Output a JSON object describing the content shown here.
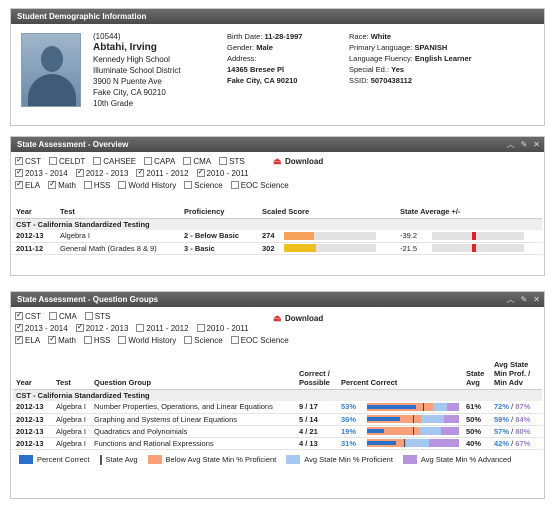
{
  "colors": {
    "header_bg": "#555555",
    "link_blue": "#3c7ec9",
    "purple": "#9e7ed0",
    "orange_bar": "#f7a25a",
    "yellow_bar": "#f0c020",
    "state_red": "#e0202a",
    "percent_blue": "#2a70c8",
    "below_orange": "#f7a07a",
    "at_blue": "#a6c8f0",
    "adv_purple": "#b794e0"
  },
  "student": {
    "header": "Student Demographic Information",
    "id": "(10544)",
    "name": "Abtahi, Irving",
    "school": "Kennedy High School",
    "district": "Illuminate School District",
    "address1": "3900 N Puente Ave",
    "address2": "Fake City, CA 90210",
    "grade": "10th Grade",
    "birth_label": "Birth Date:",
    "birth": "11-28-1997",
    "gender_label": "Gender:",
    "gender": "Male",
    "address_label": "Address:",
    "addr_line1": "14365 Bresee Pl",
    "addr_line2": "Fake City, CA 90210",
    "race_label": "Race:",
    "race": "White",
    "lang_label": "Primary Language:",
    "lang": "SPANISH",
    "fluency_label": "Language Fluency:",
    "fluency": "English Learner",
    "sped_label": "Special Ed.:",
    "sped": "Yes",
    "ssid_label": "SSID:",
    "ssid": "5070438112"
  },
  "overview": {
    "header": "State Assessment - Overview",
    "tests": [
      {
        "label": "CST",
        "checked": true
      },
      {
        "label": "CELDT",
        "checked": false
      },
      {
        "label": "CAHSEE",
        "checked": false
      },
      {
        "label": "CAPA",
        "checked": false
      },
      {
        "label": "CMA",
        "checked": false
      },
      {
        "label": "STS",
        "checked": false
      }
    ],
    "years": [
      {
        "label": "2013 - 2014",
        "checked": true
      },
      {
        "label": "2012 - 2013",
        "checked": true
      },
      {
        "label": "2011 - 2012",
        "checked": true
      },
      {
        "label": "2010 - 2011",
        "checked": true
      }
    ],
    "subjects": [
      {
        "label": "ELA",
        "checked": true
      },
      {
        "label": "Math",
        "checked": true
      },
      {
        "label": "HSS",
        "checked": false
      },
      {
        "label": "World History",
        "checked": false
      },
      {
        "label": "Science",
        "checked": false
      },
      {
        "label": "EOC Science",
        "checked": false
      }
    ],
    "download": "Download",
    "columns": [
      "Year",
      "Test",
      "Proficiency",
      "Scaled Score",
      "State Average +/-"
    ],
    "group": "CST - California Standardized Testing",
    "rows": [
      {
        "year": "2012-13",
        "test": "Algebra I",
        "prof": "2 - Below Basic",
        "score": "274",
        "score_frac": 0.33,
        "bar_color": "#f7a25a",
        "avg": "-39.2",
        "avg_frac": 0.43
      },
      {
        "year": "2011-12",
        "test": "General Math (Grades 8 & 9)",
        "prof": "3 - Basic",
        "score": "302",
        "score_frac": 0.35,
        "bar_color": "#f0c020",
        "avg": "-21.5",
        "avg_frac": 0.43
      }
    ]
  },
  "groups": {
    "header": "State Assessment - Question Groups",
    "tests": [
      {
        "label": "CST",
        "checked": true
      },
      {
        "label": "CMA",
        "checked": false
      },
      {
        "label": "STS",
        "checked": false
      }
    ],
    "years": [
      {
        "label": "2013 - 2014",
        "checked": true
      },
      {
        "label": "2012 - 2013",
        "checked": true
      },
      {
        "label": "2011 - 2012",
        "checked": false
      },
      {
        "label": "2010 - 2011",
        "checked": false
      }
    ],
    "subjects": [
      {
        "label": "ELA",
        "checked": true
      },
      {
        "label": "Math",
        "checked": true
      },
      {
        "label": "HSS",
        "checked": false
      },
      {
        "label": "World History",
        "checked": false
      },
      {
        "label": "Science",
        "checked": false
      },
      {
        "label": "EOC Science",
        "checked": false
      }
    ],
    "download": "Download",
    "col_year": "Year",
    "col_test": "Test",
    "col_qgroup": "Question Group",
    "col_correct": "Correct / Possible",
    "col_pct": "Percent Correct",
    "col_state": "State Avg",
    "col_minprof": "Avg State Min Prof. / Min Adv",
    "group": "CST - California Standardized Testing",
    "rows": [
      {
        "year": "2012-13",
        "test": "Algebra I",
        "qgroup": "Number Properties, Operations, and Linear Equations",
        "correct": "9 / 17",
        "pct": "53%",
        "pct_v": 53,
        "state": "61%",
        "state_v": 61,
        "minprof": "72%",
        "minadv": "87%",
        "prof_v": 72,
        "adv_v": 87
      },
      {
        "year": "2012-13",
        "test": "Algebra I",
        "qgroup": "Graphing and Systems of Linear Equations",
        "correct": "5 / 14",
        "pct": "36%",
        "pct_v": 36,
        "state": "50%",
        "state_v": 50,
        "minprof": "59%",
        "minadv": "84%",
        "prof_v": 59,
        "adv_v": 84
      },
      {
        "year": "2012-13",
        "test": "Algebra I",
        "qgroup": "Quadratics and Polynomials",
        "correct": "4 / 21",
        "pct": "19%",
        "pct_v": 19,
        "state": "50%",
        "state_v": 50,
        "minprof": "57%",
        "minadv": "80%",
        "prof_v": 57,
        "adv_v": 80
      },
      {
        "year": "2012-13",
        "test": "Algebra I",
        "qgroup": "Functions and Rational Expressions",
        "correct": "4 / 13",
        "pct": "31%",
        "pct_v": 31,
        "state": "40%",
        "state_v": 40,
        "minprof": "42%",
        "minadv": "67%",
        "prof_v": 42,
        "adv_v": 67
      }
    ],
    "legend": [
      {
        "label": "Percent Correct",
        "color": "#2a70c8",
        "kind": "swatch"
      },
      {
        "label": "State Avg",
        "color": "#555555",
        "kind": "line"
      },
      {
        "label": "Below Avg State Min % Proficient",
        "color": "#f7a07a",
        "kind": "swatch"
      },
      {
        "label": "Avg State Min % Proficient",
        "color": "#a6c8f0",
        "kind": "swatch"
      },
      {
        "label": "Avg State Min % Advanced",
        "color": "#b794e0",
        "kind": "swatch"
      }
    ]
  }
}
